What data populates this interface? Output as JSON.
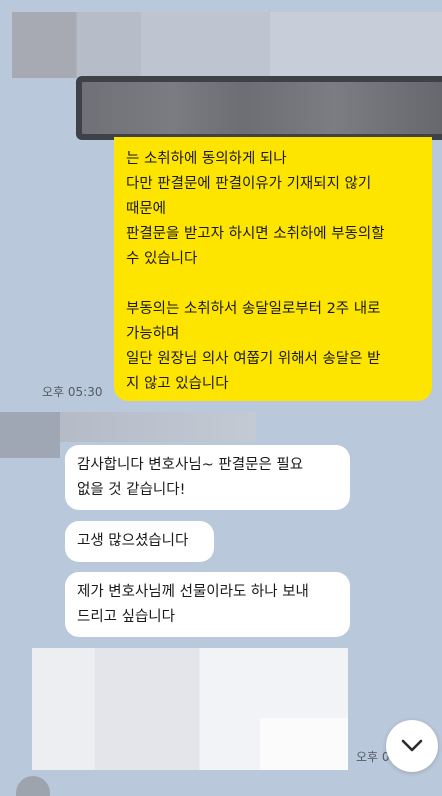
{
  "outgoing_message": {
    "lines": [
      "는 소취하에 동의하게 되나",
      "다만 판결문에 판결이유가 기재되지 않기",
      "때문에",
      "판결문을 받고자 하시면 소취하에 부동의할",
      "수 있습니다",
      "",
      "부동의는 소취하서 송달일로부터 2주 내로",
      "가능하며",
      "일단 원장님 의사 여쭙기 위해서 송달은 받",
      "지 않고 있습니다"
    ],
    "time": "오후 05:30"
  },
  "incoming_messages": [
    {
      "lines": [
        "감사합니다 변호사님~ 판결문은 필요",
        "없을 것 같습니다!"
      ]
    },
    {
      "lines": [
        "고생 많으셨습니다"
      ]
    },
    {
      "lines": [
        "제가 변호사님께 선물이라도 하나 보내",
        "드리고 싶습니다"
      ]
    }
  ],
  "last_time": "오후 0",
  "colors": {
    "background": "#b9c8da",
    "outgoing_bubble": "#fee500",
    "incoming_bubble": "#ffffff"
  },
  "icons": {
    "scroll_down": "chevron-down-icon"
  }
}
